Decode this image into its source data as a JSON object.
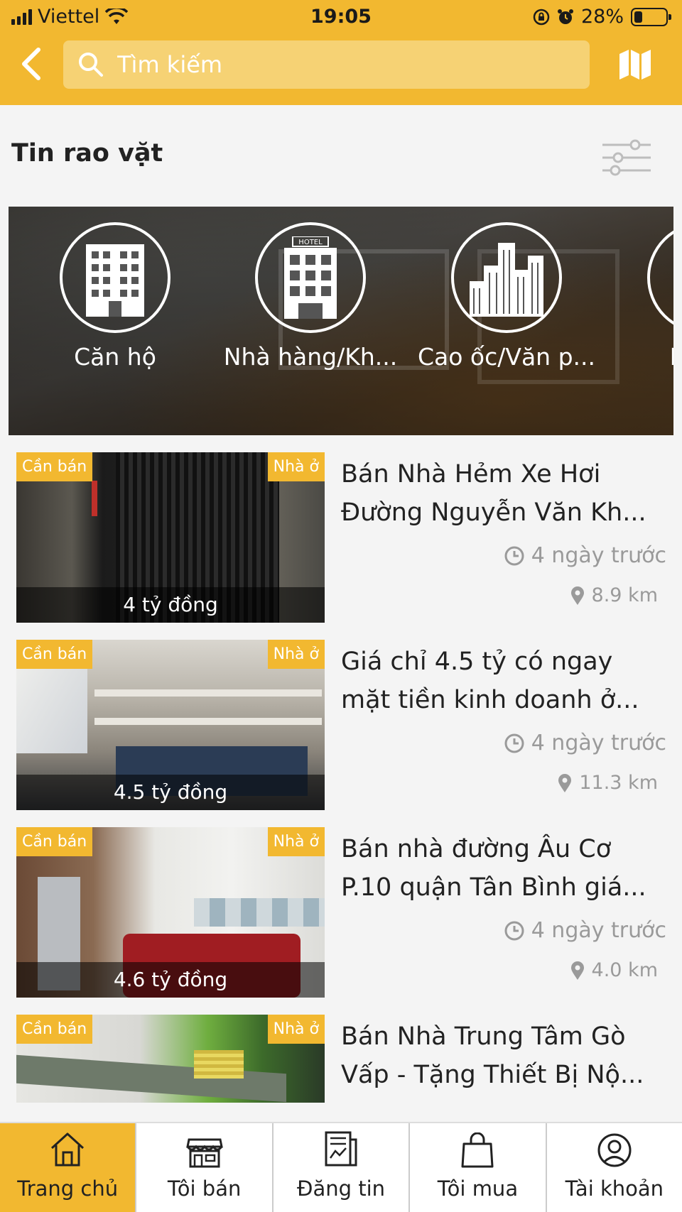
{
  "status_bar": {
    "carrier": "Viettel",
    "time": "19:05",
    "battery": "28%",
    "battery_level": 0.28
  },
  "header": {
    "search_placeholder": "Tìm kiếm",
    "back_icon": "chevron-left-icon",
    "map_icon": "map-icon"
  },
  "section": {
    "title": "Tin rao vặt",
    "filter_icon": "sliders-icon"
  },
  "categories": [
    {
      "label": "Căn hộ",
      "icon": "apartment-building-icon"
    },
    {
      "label": "Nhà hàng/Kh...",
      "icon": "hotel-icon",
      "sign": "HOTEL"
    },
    {
      "label": "Cao ốc/Văn p...",
      "icon": "skyscrapers-icon"
    },
    {
      "label": "Kho x",
      "icon": "warehouse-icon"
    }
  ],
  "listings": [
    {
      "tag_left": "Cần bán",
      "tag_right": "Nhà ở",
      "price": "4 tỷ đồng",
      "title_line1": "Bán Nhà Hẻm Xe Hơi",
      "title_line2": "Đường Nguyễn Văn Kh...",
      "time": "4 ngày trước",
      "distance": "8.9 km"
    },
    {
      "tag_left": "Cần bán",
      "tag_right": "Nhà ở",
      "price": "4.5 tỷ đồng",
      "title_line1": "Giá chỉ 4.5 tỷ có ngay",
      "title_line2": "mặt tiền kinh doanh ở...",
      "time": "4 ngày trước",
      "distance": "11.3 km"
    },
    {
      "tag_left": "Cần bán",
      "tag_right": "Nhà ở",
      "price": "4.6 tỷ đồng",
      "title_line1": "Bán nhà đường Âu Cơ",
      "title_line2": "P.10 quận Tân Bình giá...",
      "time": "4 ngày trước",
      "distance": "4.0 km"
    },
    {
      "tag_left": "Cần bán",
      "tag_right": "Nhà ở",
      "title_line1": "Bán Nhà Trung Tâm Gò",
      "title_line2": "Vấp - Tặng Thiết Bị Nộ..."
    }
  ],
  "bottom_nav": [
    {
      "label": "Trang chủ",
      "icon": "home-icon",
      "active": true
    },
    {
      "label": "Tôi bán",
      "icon": "store-icon",
      "active": false
    },
    {
      "label": "Đăng tin",
      "icon": "newspaper-icon",
      "active": false
    },
    {
      "label": "Tôi mua",
      "icon": "shopping-bag-icon",
      "active": false
    },
    {
      "label": "Tài khoản",
      "icon": "user-circle-icon",
      "active": false
    }
  ],
  "colors": {
    "accent": "#f2b830",
    "search_bg": "#f6d274",
    "meta_text": "#9a9a9a"
  }
}
